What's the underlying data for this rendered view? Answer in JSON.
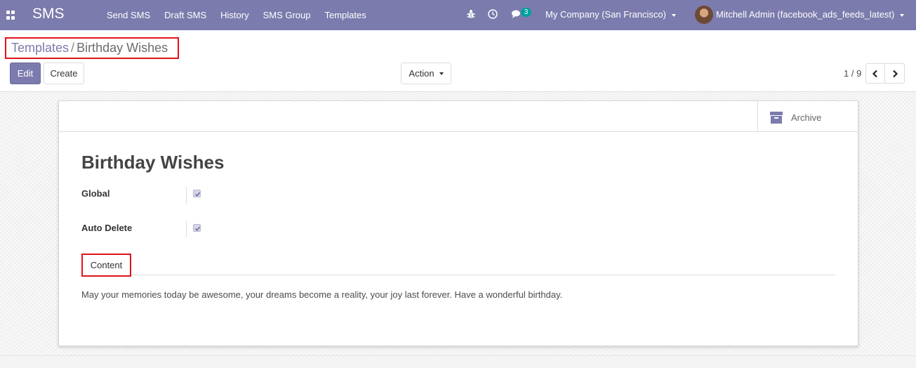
{
  "navbar": {
    "brand": "SMS",
    "menu": [
      "Send SMS",
      "Draft SMS",
      "History",
      "SMS Group",
      "Templates"
    ],
    "message_count": "3",
    "company": "My Company (San Francisco)",
    "user": "Mitchell Admin (facebook_ads_feeds_latest)",
    "icons": [
      "apps-grid-icon",
      "bug-icon",
      "clock-icon",
      "chat-icon"
    ]
  },
  "breadcrumb": {
    "parent": "Templates",
    "separator": "/",
    "current": "Birthday Wishes"
  },
  "buttons": {
    "edit": "Edit",
    "create": "Create",
    "action": "Action"
  },
  "pager": {
    "value": "1 / 9"
  },
  "record": {
    "archive_label": "Archive",
    "title": "Birthday Wishes",
    "fields": {
      "global_label": "Global",
      "global_checked": true,
      "auto_delete_label": "Auto Delete",
      "auto_delete_checked": true
    },
    "tabs": [
      "Content"
    ],
    "content_text": "May your memories today be awesome, your dreams become a reality, your joy last forever. Have a wonderful birthday."
  },
  "colors": {
    "brand": "#7c7bad",
    "badge": "#00a09d",
    "highlight": "#e2121b"
  }
}
